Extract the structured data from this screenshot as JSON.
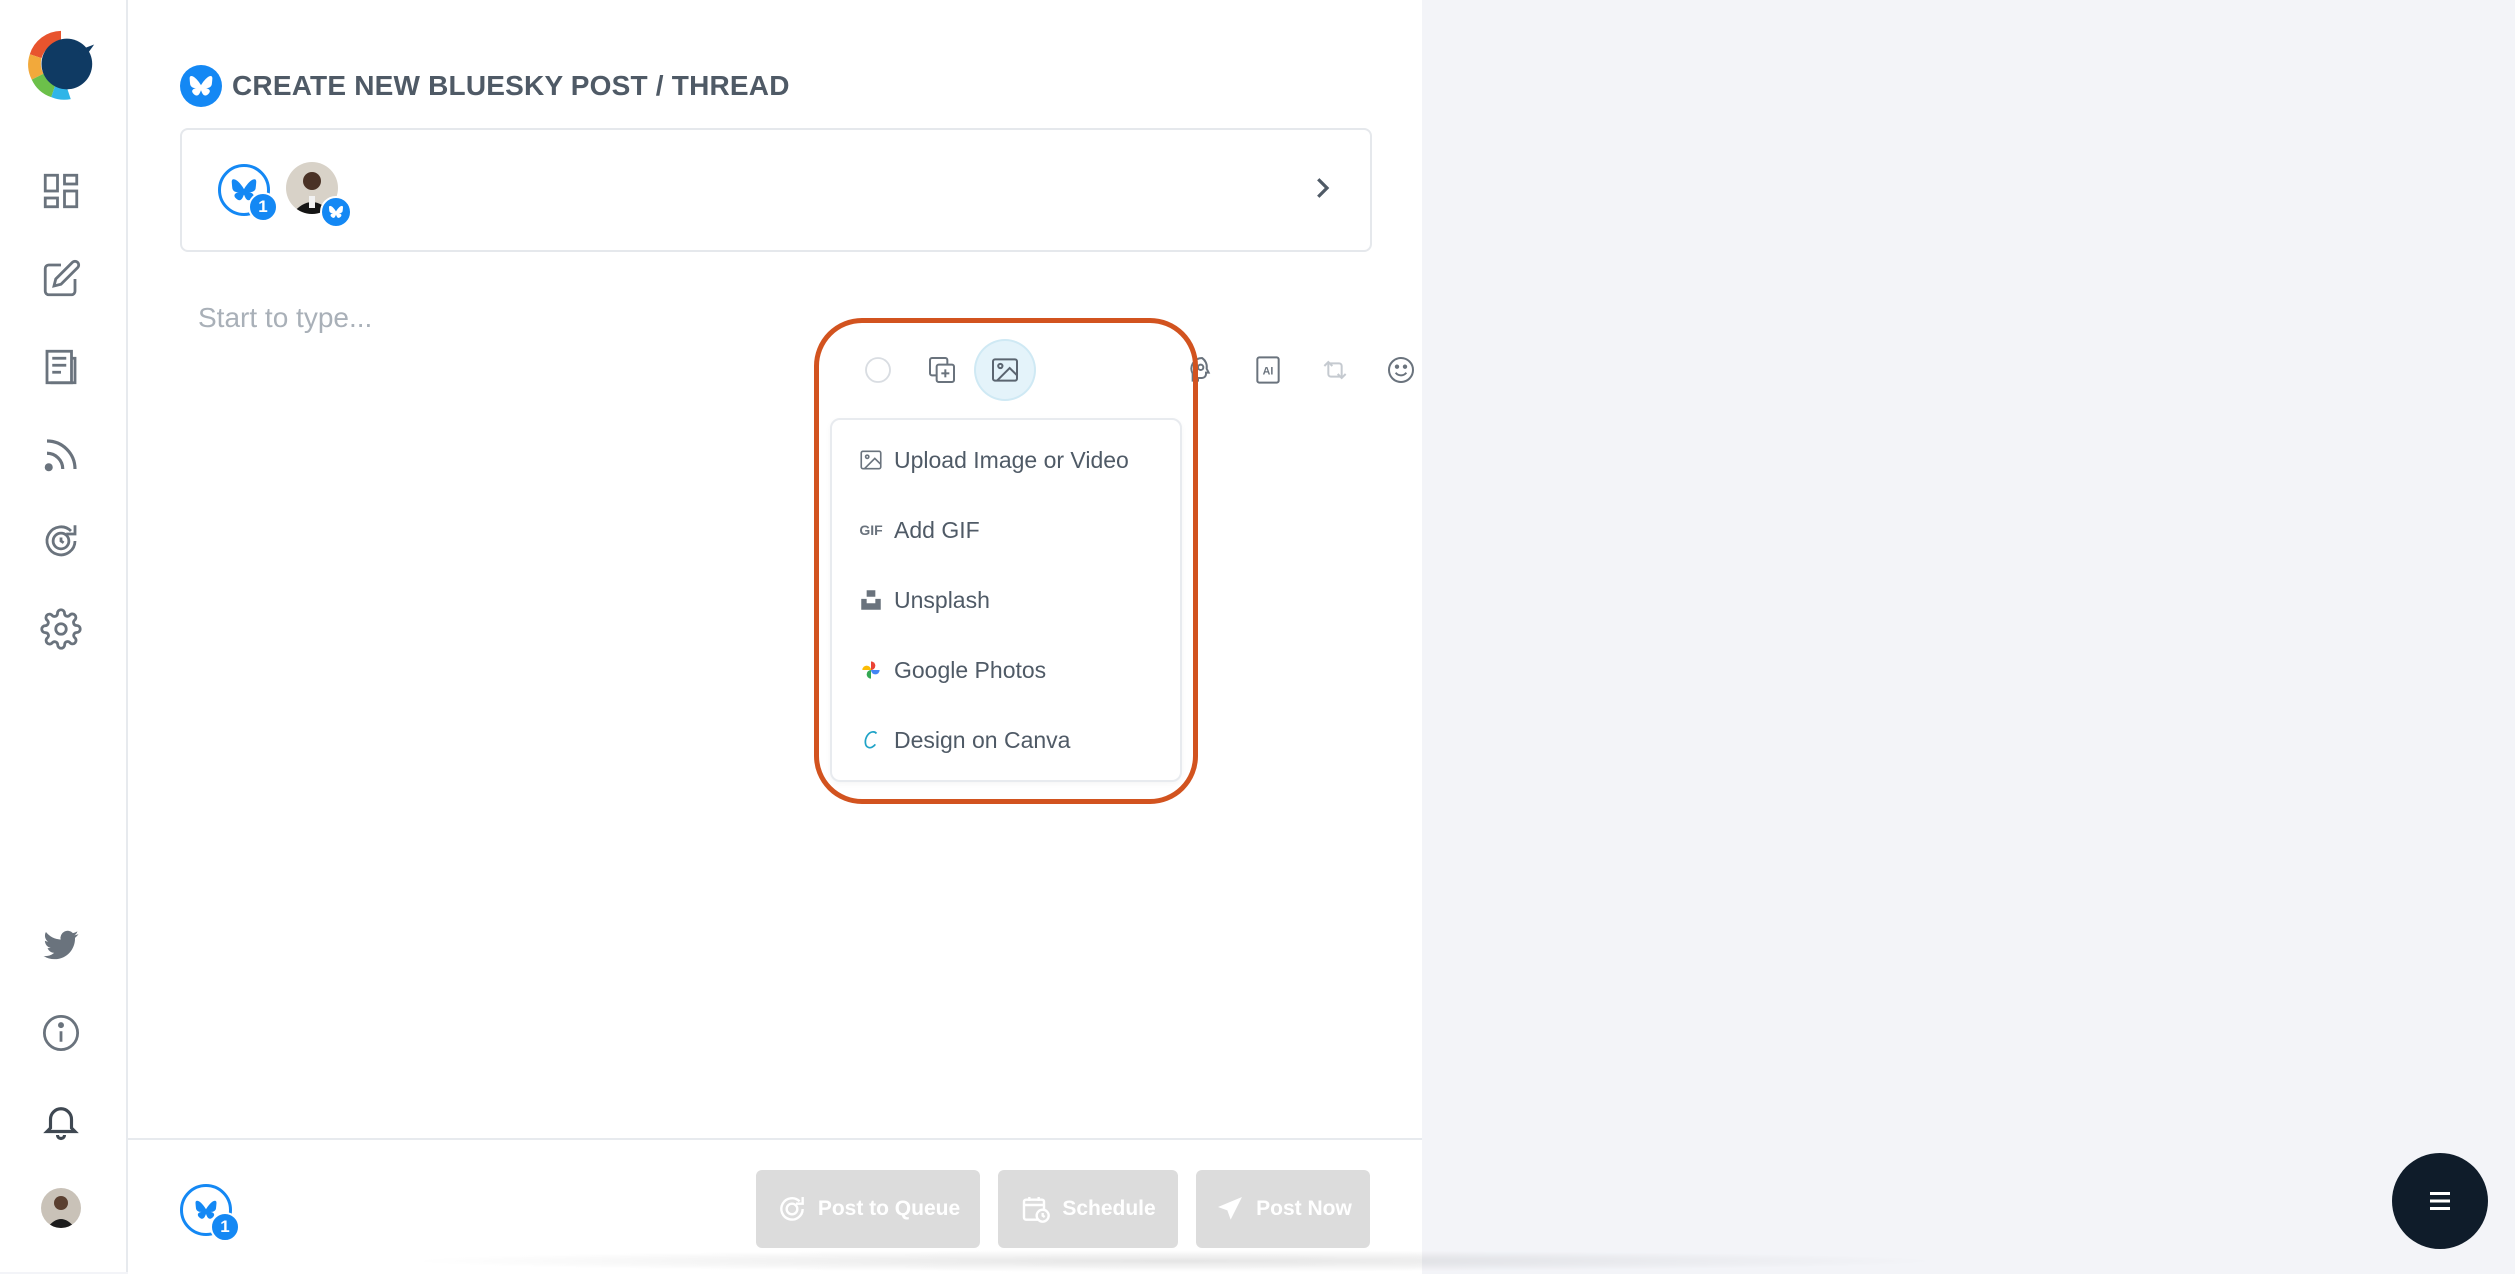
{
  "header": {
    "title": "CREATE NEW BLUESKY POST / THREAD"
  },
  "accounts": {
    "selected_count": "1"
  },
  "composer": {
    "placeholder": "Start to type..."
  },
  "media_menu": {
    "items": [
      {
        "label": "Upload Image or Video",
        "icon": "image-icon"
      },
      {
        "label": "Add GIF",
        "icon": "gif-icon"
      },
      {
        "label": "Unsplash",
        "icon": "unsplash-icon"
      },
      {
        "label": "Google Photos",
        "icon": "google-photos-icon"
      },
      {
        "label": "Design on Canva",
        "icon": "canva-icon"
      }
    ],
    "gif_icon_text": "GIF"
  },
  "footer": {
    "account_count": "1",
    "post_to_queue": "Post to Queue",
    "schedule": "Schedule",
    "post_now": "Post Now"
  },
  "toolbar": {
    "icons": [
      "circle-icon",
      "add-thread-icon",
      "image-icon",
      "brain-icon",
      "ai-icon",
      "retweet-icon",
      "emoji-icon",
      "trash-icon"
    ]
  },
  "colors": {
    "bluesky": "#1488f4",
    "highlight": "#d2531f",
    "button_disabled": "#dcdcdc",
    "fab": "#0f1c2a"
  }
}
